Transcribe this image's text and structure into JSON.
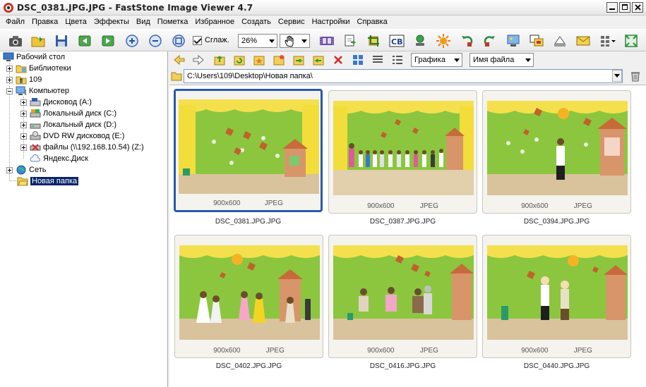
{
  "window": {
    "title": "DSC_0381.JPG.JPG  -  FastStone Image Viewer 4.7"
  },
  "menu": [
    "Файл",
    "Правка",
    "Цвета",
    "Эффекты",
    "Вид",
    "Пометка",
    "Избранное",
    "Создать",
    "Сервис",
    "Настройки",
    "Справка"
  ],
  "toolbar": {
    "smooth_label": "Сглаж.",
    "zoom_value": "26%"
  },
  "tree": {
    "desktop": "Рабочий стол",
    "libraries": "Библиотеки",
    "user": "109",
    "computer": "Компьютер",
    "drives": [
      "Дисковод (A:)",
      "Локальный диск (C:)",
      "Локальный диск (D:)",
      "DVD RW дисковод (E:)",
      "файлы (\\\\192.168.10.54) (Z:)",
      "Яндекс.Диск"
    ],
    "network": "Сеть",
    "new_folder": "Новая папка"
  },
  "panel": {
    "filter_value": "Графика",
    "sort_value": "Имя файла"
  },
  "path": {
    "value": "C:\\Users\\109\\Desktop\\Новая папка\\"
  },
  "thumbnails": [
    {
      "name": "DSC_0381.JPG.JPG",
      "size": "900x600",
      "format": "JPEG",
      "selected": true
    },
    {
      "name": "DSC_0387.JPG.JPG",
      "size": "900x600",
      "format": "JPEG",
      "selected": false
    },
    {
      "name": "DSC_0394.JPG.JPG",
      "size": "900x600",
      "format": "JPEG",
      "selected": false
    },
    {
      "name": "DSC_0402.JPG.JPG",
      "size": "900x600",
      "format": "JPEG",
      "selected": false
    },
    {
      "name": "DSC_0416.JPG.JPG",
      "size": "900x600",
      "format": "JPEG",
      "selected": false
    },
    {
      "name": "DSC_0440.JPG.JPG",
      "size": "900x600",
      "format": "JPEG",
      "selected": false
    }
  ],
  "colors": {
    "selection": "#2b5aa8",
    "tree_selected": "#0a246a"
  }
}
